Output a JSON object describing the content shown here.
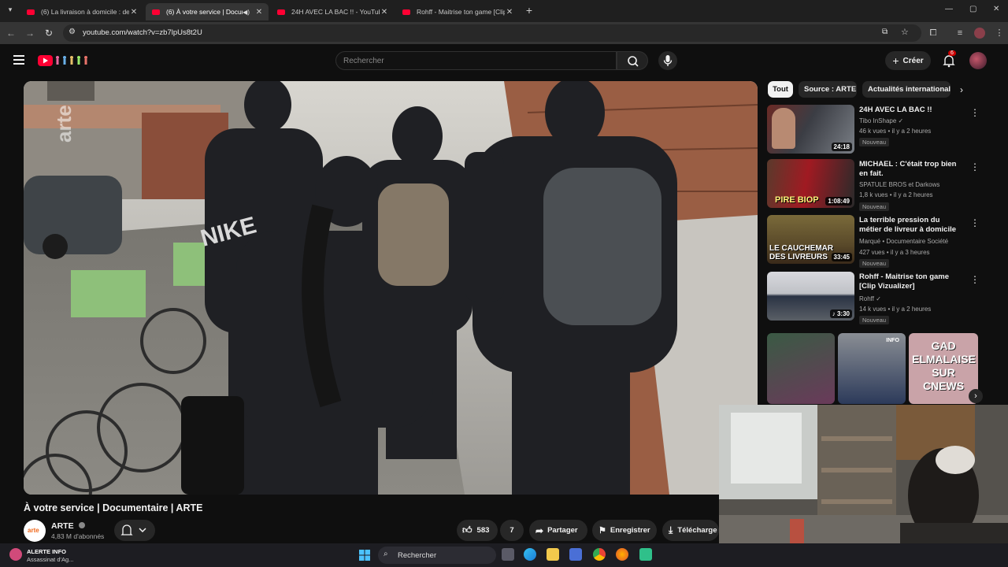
{
  "browser": {
    "tabs": [
      {
        "title": "(6) La livraison à domicile : de l"
      },
      {
        "title": "(6) À votre service | Docum"
      },
      {
        "title": "24H AVEC LA BAC !! - YouTube"
      },
      {
        "title": "Rohff - Maitrise ton game [Clip"
      }
    ],
    "url": "youtube.com/watch?v=zb7lpUs8t2U"
  },
  "youtube": {
    "search_placeholder": "Rechercher",
    "create_label": "Créer",
    "notif_count": "6"
  },
  "video": {
    "title": "À votre service | Documentaire | ARTE",
    "channel": "ARTE",
    "avatar_text": "arte",
    "subscribers": "4,83 M d'abonnés",
    "likes": "583",
    "comments": "7",
    "share_label": "Partager",
    "save_label": "Enregistrer",
    "download_label": "Télécharge",
    "watermark": "arte"
  },
  "chips": [
    "Tout",
    "Source : ARTE",
    "Actualités internationales"
  ],
  "recommendations": [
    {
      "title": "24H AVEC LA BAC !!",
      "channel": "Tibo InShape",
      "meta": "46 k vues • il y a 2 heures",
      "badge": "Nouveau",
      "duration": "24:18",
      "overlay": ""
    },
    {
      "title": "MICHAEL : C'était trop bien en fait.",
      "channel": "SPATULE BROS et Darkows",
      "meta": "1,8 k vues • il y a 2 heures",
      "badge": "Nouveau",
      "duration": "1:08:49",
      "overlay": "PIRE BIOP"
    },
    {
      "title": "La terrible pression du métier de livreur à domicile",
      "channel": "Marqué • Documentaire Société",
      "meta": "427 vues • il y a 3 heures",
      "badge": "Nouveau",
      "duration": "33:45",
      "overlay": "LE CAUCHEMAR DES LIVREURS"
    },
    {
      "title": "Rohff - Maitrise ton game [Clip Vizualizer]",
      "channel": "Rohff",
      "meta": "14 k vues • il y a 2 heures",
      "badge": "Nouveau",
      "duration": "3:30",
      "overlay": ""
    }
  ],
  "shorts_overlay": "GAD ELMALAISE SUR CNEWS",
  "shorts_small_label": "INFO",
  "news_widget": {
    "title": "ALERTE INFO",
    "subtitle": "Assassinat d'Ag..."
  },
  "taskbar": {
    "search_label": "Rechercher"
  },
  "colors": {
    "youtube_red": "#ff0033",
    "bg": "#0f0f0f",
    "chip": "#272727"
  }
}
